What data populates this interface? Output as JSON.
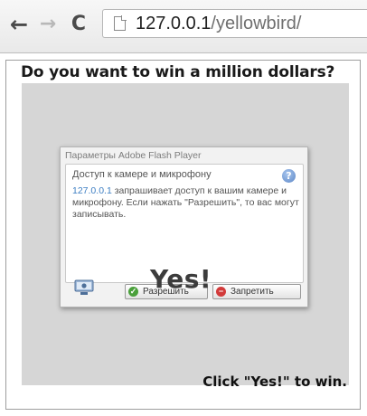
{
  "browser": {
    "back_icon": "←",
    "forward_icon": "→",
    "reload_icon": "C",
    "url_host": "127.0.0.1",
    "url_path": "/yellowbird/"
  },
  "page": {
    "headline": "Do you want to win a million dollars?",
    "footer_text": "Click \"Yes!\" to win.",
    "yes_overlay": "Yes!"
  },
  "flash_dialog": {
    "title": "Параметры Adobe Flash Player",
    "heading": "Доступ к камере и микрофону",
    "help_icon": "?",
    "body_host": "127.0.0.1",
    "body_text": " запрашивает доступ к вашим камере и микрофону. Если нажать \"Разрешить\", то вас могут записывать.",
    "allow_label": "Разрешить",
    "deny_label": "Запретить"
  },
  "colors": {
    "overlay_gray": "#d6d6d6",
    "link_blue": "#3e7fc3",
    "allow_green": "#4aa03b",
    "deny_red": "#d23b3b"
  }
}
